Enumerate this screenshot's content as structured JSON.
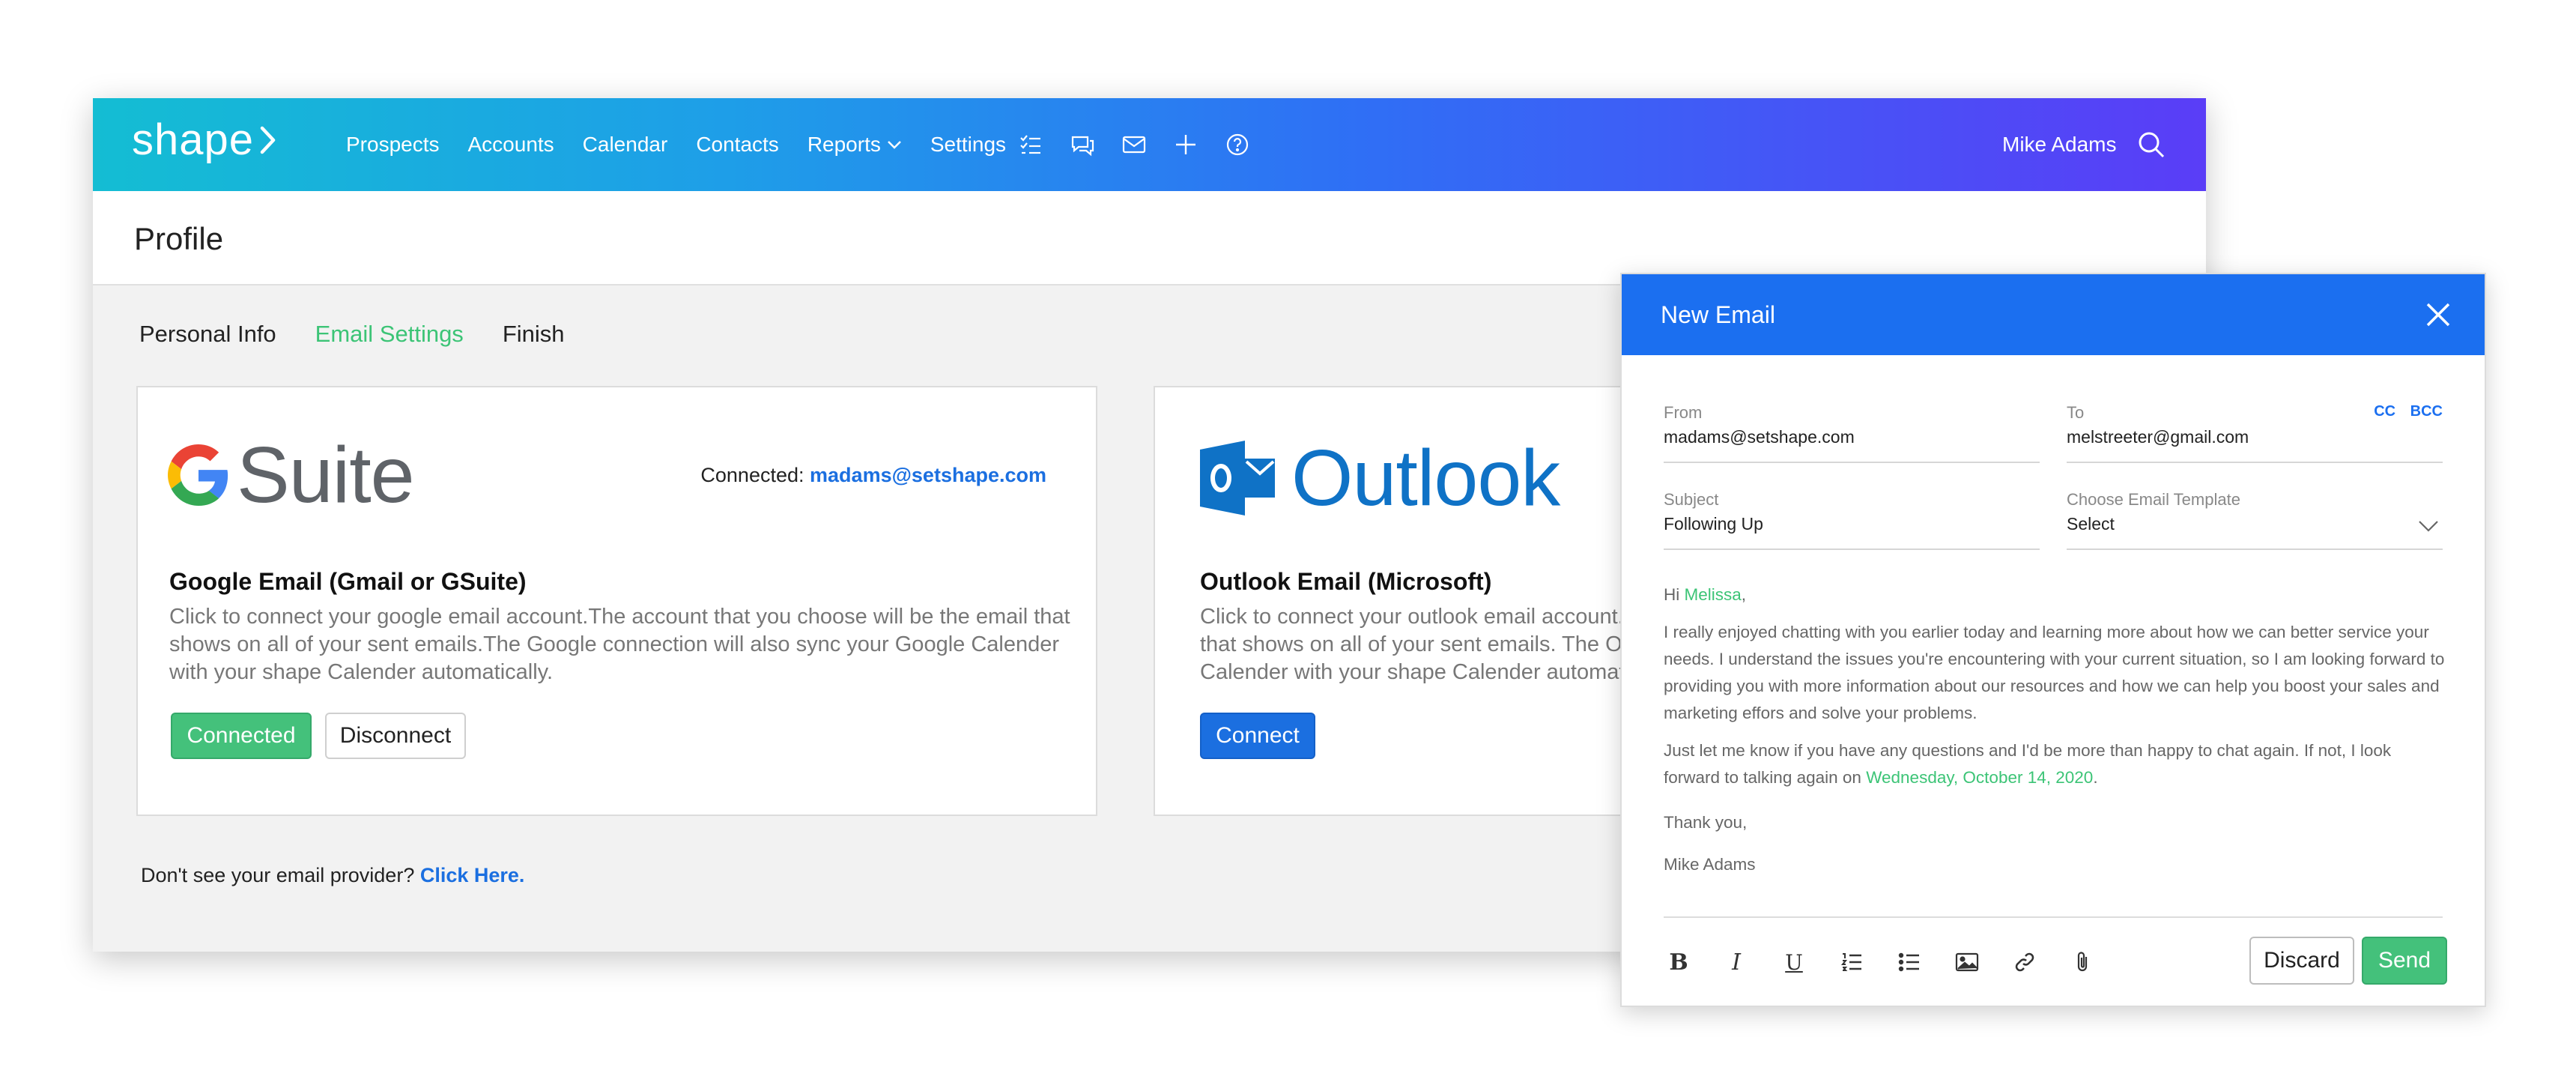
{
  "navbar": {
    "brand": "shape",
    "links": [
      "Prospects",
      "Accounts",
      "Calendar",
      "Contacts",
      "Reports",
      "Settings"
    ],
    "icons": [
      "task-list-icon",
      "chat-icon",
      "mail-icon",
      "plus-icon",
      "help-icon"
    ],
    "user_name": "Mike Adams"
  },
  "page": {
    "title": "Profile",
    "tabs": [
      "Personal Info",
      "Email Settings",
      "Finish"
    ],
    "active_tab": "Email Settings"
  },
  "gsuite": {
    "logo_text": "Suite",
    "connected_prefix": "Connected:",
    "connected_email": "madams@setshape.com",
    "title": "Google Email (Gmail or GSuite)",
    "description": "Click to connect your google email account.The account that you choose will be the email that shows on all of your sent emails.The Google connection will also sync your Google Calender with your shape Calender automatically.",
    "connected_label": "Connected",
    "disconnect_label": "Disconnect"
  },
  "outlook": {
    "logo_text": "Outlook",
    "title": "Outlook Email (Microsoft)",
    "description": "Click to connect your outlook email account. The account that you choose will be the email that shows on all of your sent emails. The Outlook connection will also sync your Outlook Calender with your shape Calender automatically.",
    "connect_label": "Connect"
  },
  "footer": {
    "prompt": "Don't see your email provider?",
    "link": "Click Here."
  },
  "email_modal": {
    "title": "New Email",
    "from_label": "From",
    "from_value": "madams@setshape.com",
    "to_label": "To",
    "to_value": "melstreeter@gmail.com",
    "cc": "CC",
    "bcc": "BCC",
    "subject_label": "Subject",
    "subject_value": "Following Up",
    "template_label": "Choose Email Template",
    "template_value": "Select",
    "greeting": "Hi",
    "recipient_name": "Melissa",
    "greeting_punct": ",",
    "paragraph1": "I really enjoyed chatting with you earlier today and learning more about how we can better service your needs. I understand the issues you're encountering with your current situation, so I am looking forward to providing you with more information about our resources and how we can help you boost your sales and marketing effors and solve your problems.",
    "paragraph2_start": "Just let me know if you have any questions and I'd be more than happy to chat again. If not, I look forward to talking again on",
    "paragraph2_date": "Wednesday, October 14, 2020",
    "paragraph2_end": ".",
    "signoff": "Thank you,",
    "signature": "Mike Adams",
    "discard_label": "Discard",
    "send_label": "Send"
  },
  "colors": {
    "accent_green": "#44c17b",
    "link_blue": "#1b6fe0",
    "modal_header": "#1b6ff0"
  }
}
